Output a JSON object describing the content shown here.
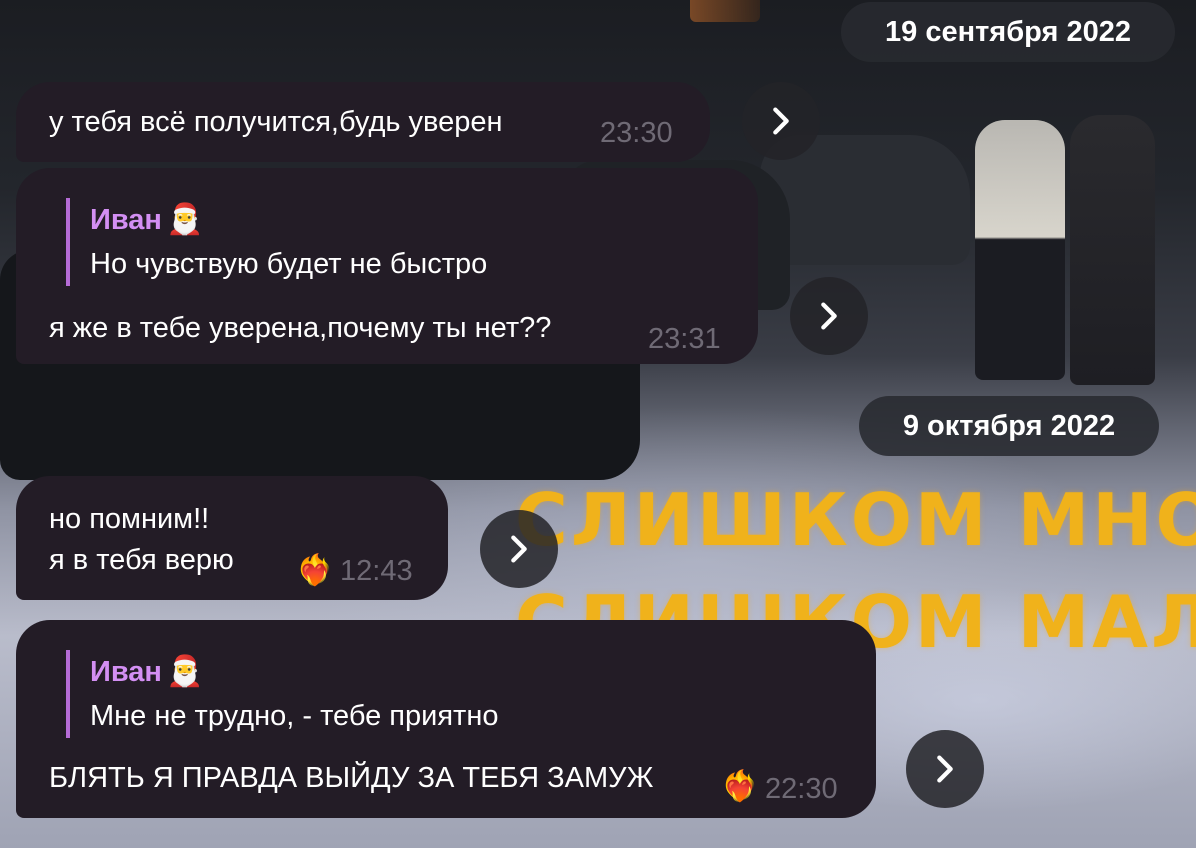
{
  "dates": [
    "19 сентября 2022",
    "9 октября 2022"
  ],
  "background_overlay": [
    "СЛИШКОМ МНОГО",
    "СЛИШКОМ МАЛО С"
  ],
  "messages": [
    {
      "text": "у тебя всё получится,будь уверен",
      "time": "23:30"
    },
    {
      "reply_author": "Иван",
      "reply_text": "Но чувствую будет не быстро",
      "text": "я же в тебе уверена,почему ты нет??",
      "time": "23:31"
    },
    {
      "lines": [
        "но помним!!",
        "я в тебя верю"
      ],
      "reaction": "heart-on-fire",
      "time": "12:43"
    },
    {
      "reply_author": "Иван",
      "reply_text": "Мне не трудно, - тебе приятно",
      "text": "БЛЯТЬ Я ПРАВДА ВЫЙДУ ЗА ТЕБЯ ЗАМУЖ",
      "reaction": "heart-on-fire",
      "time": "22:30"
    }
  ],
  "icons": {
    "forward": "chevron-right-icon",
    "author_emoji": "santa-emoji",
    "reaction": "burning-heart-icon"
  },
  "colors": {
    "bubble": "#231c26",
    "author": "#d38ff3",
    "reply_bar": "#b56cd6",
    "time": "#6f6a75"
  }
}
